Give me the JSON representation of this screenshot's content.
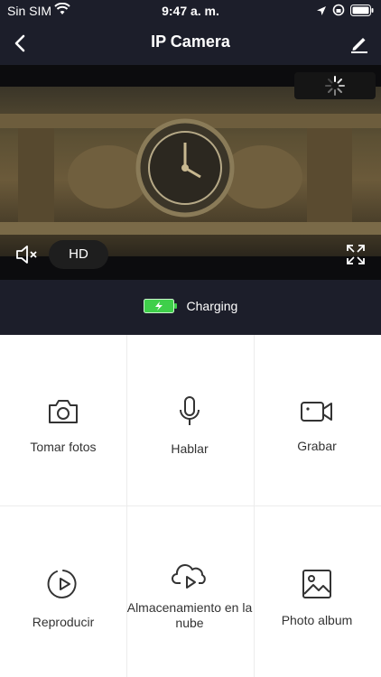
{
  "status_bar": {
    "carrier": "Sin SIM",
    "time": "9:47 a. m."
  },
  "nav": {
    "title": "IP Camera"
  },
  "video": {
    "quality_label": "HD"
  },
  "device_status": {
    "charging_label": "Charging"
  },
  "actions": [
    {
      "label": "Tomar fotos",
      "icon": "camera-icon"
    },
    {
      "label": "Hablar",
      "icon": "microphone-icon"
    },
    {
      "label": "Grabar",
      "icon": "video-camera-icon"
    },
    {
      "label": "Reproducir",
      "icon": "playback-icon"
    },
    {
      "label": "Almacenamiento en la nube",
      "icon": "cloud-play-icon"
    },
    {
      "label": "Photo album",
      "icon": "image-icon"
    }
  ],
  "colors": {
    "header_bg": "#1c1e2a",
    "battery_green": "#3fcf4a"
  }
}
